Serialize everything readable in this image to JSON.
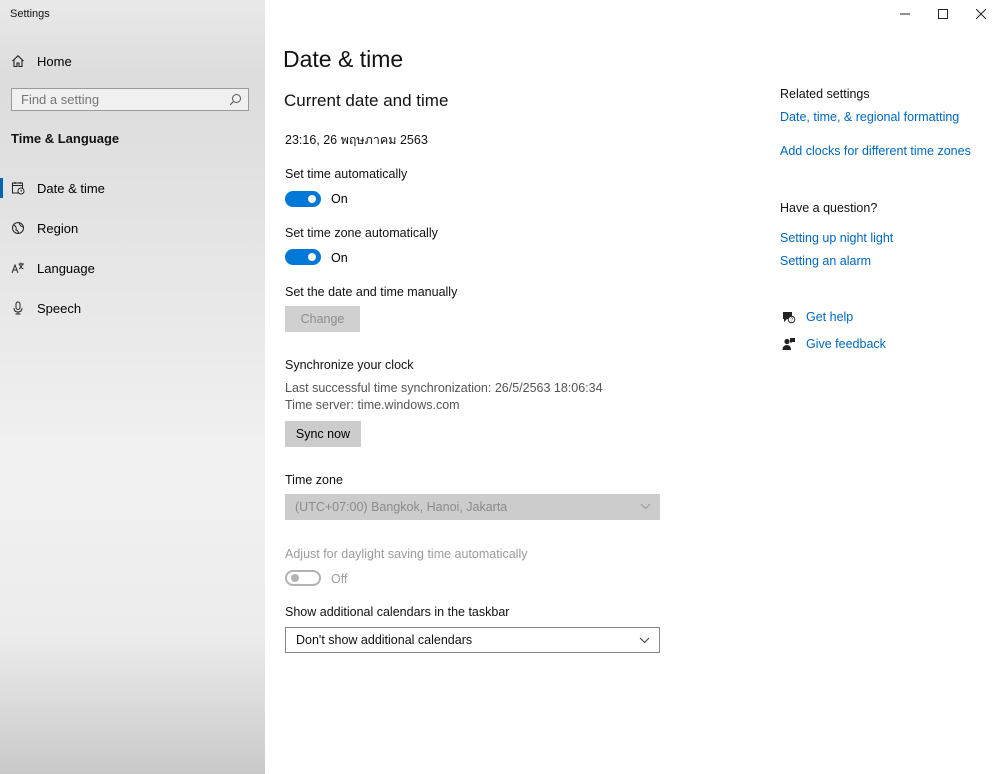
{
  "window": {
    "title": "Settings"
  },
  "sidebar": {
    "home_label": "Home",
    "search_placeholder": "Find a setting",
    "section_title": "Time & Language",
    "items": [
      {
        "label": "Date & time",
        "icon": "date-time-icon",
        "selected": true
      },
      {
        "label": "Region",
        "icon": "globe-icon",
        "selected": false
      },
      {
        "label": "Language",
        "icon": "language-icon",
        "selected": false
      },
      {
        "label": "Speech",
        "icon": "microphone-icon",
        "selected": false
      }
    ]
  },
  "main": {
    "page_title": "Date & time",
    "current_heading": "Current date and time",
    "current_value": "23:16, 26 พฤษภาคม 2563",
    "set_time_auto": {
      "label": "Set time automatically",
      "state": "On"
    },
    "set_tz_auto": {
      "label": "Set time zone automatically",
      "state": "On"
    },
    "manual": {
      "label": "Set the date and time manually",
      "button": "Change"
    },
    "sync": {
      "heading": "Synchronize your clock",
      "last_sync": "Last successful time synchronization: 26/5/2563 18:06:34",
      "server": "Time server: time.windows.com",
      "button": "Sync now"
    },
    "time_zone": {
      "label": "Time zone",
      "value": "(UTC+07:00) Bangkok, Hanoi, Jakarta"
    },
    "dst": {
      "label": "Adjust for daylight saving time automatically",
      "state": "Off"
    },
    "calendars": {
      "label": "Show additional calendars in the taskbar",
      "value": "Don't show additional calendars"
    }
  },
  "related": {
    "heading": "Related settings",
    "links": [
      "Date, time, & regional formatting",
      "Add clocks for different time zones"
    ],
    "question_heading": "Have a question?",
    "question_links": [
      "Setting up night light",
      "Setting an alarm"
    ],
    "get_help": "Get help",
    "give_feedback": "Give feedback"
  },
  "colors": {
    "accent": "#0078d7",
    "link": "#0067c0"
  }
}
